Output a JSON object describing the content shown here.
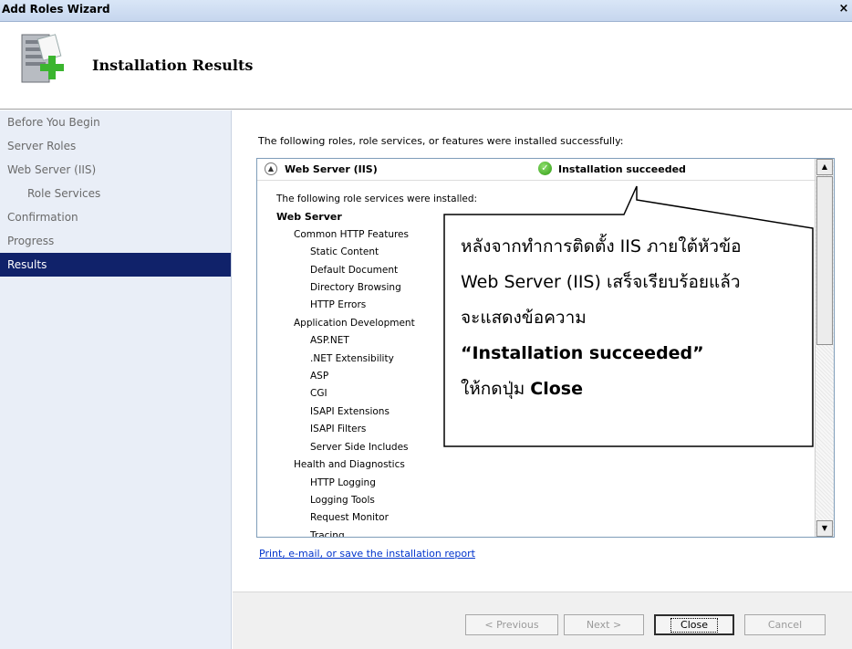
{
  "window": {
    "title": "Add Roles Wizard",
    "close_glyph": "×"
  },
  "header": {
    "title": "Installation Results",
    "icon": "server-add-icon"
  },
  "nav": {
    "items": [
      {
        "label": "Before You Begin"
      },
      {
        "label": "Server Roles"
      },
      {
        "label": "Web Server (IIS)"
      },
      {
        "label": "Role Services"
      },
      {
        "label": "Confirmation"
      },
      {
        "label": "Progress"
      },
      {
        "label": "Results"
      }
    ]
  },
  "main": {
    "intro": "The following roles, role services, or features were installed successfully:",
    "result": {
      "role": "Web Server (IIS)",
      "status": "Installation succeeded",
      "subtitle": "The following role services were installed:",
      "tree": [
        "Web Server",
        "Common HTTP Features",
        "Static Content",
        "Default Document",
        "Directory Browsing",
        "HTTP Errors",
        "Application Development",
        "ASP.NET",
        ".NET Extensibility",
        "ASP",
        "CGI",
        "ISAPI Extensions",
        "ISAPI Filters",
        "Server Side Includes",
        "Health and Diagnostics",
        "HTTP Logging",
        "Logging Tools",
        "Request Monitor",
        "Tracing"
      ]
    },
    "report_link": "Print, e-mail, or save the installation report"
  },
  "callout": {
    "line1": "หลังจากทำการติดตั้ง IIS ภายใต้หัวข้อ",
    "line2": "Web Server (IIS) เสร็จเรียบร้อยแล้ว",
    "line3": "จะแสดงข้อความ",
    "line4": "“Installation  succeeded”",
    "line5_prefix": "ให้กดปุ่ม ",
    "line5_bold": "Close"
  },
  "buttons": {
    "previous": "< Previous",
    "next": "Next >",
    "close": "Close",
    "cancel": "Cancel"
  }
}
